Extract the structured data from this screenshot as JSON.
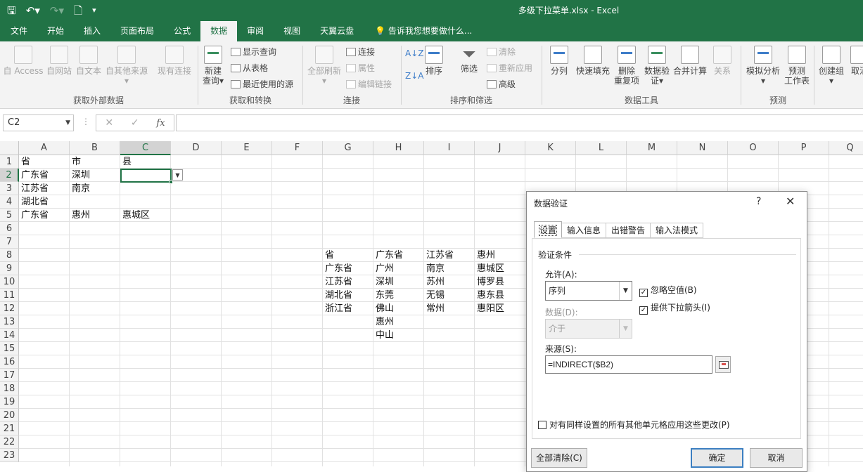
{
  "titlebar": {
    "doc_title": "多级下拉菜单.xlsx - Excel",
    "qat": {
      "save_icon": "save-icon",
      "undo_icon": "undo-icon",
      "redo_icon": "redo-icon",
      "new_icon": "new-file-icon",
      "customize_icon": "customize-qat-icon"
    }
  },
  "tabs": [
    "文件",
    "开始",
    "插入",
    "页面布局",
    "公式",
    "数据",
    "审阅",
    "视图",
    "天翼云盘"
  ],
  "active_tab": "数据",
  "tell_me": "告诉我您想要做什么...",
  "ribbon": {
    "external": {
      "access": "自 Access",
      "web": "自网站",
      "text": "自文本",
      "other": "自其他来源",
      "existing": "现有连接",
      "group": "获取外部数据"
    },
    "transform": {
      "new_query_1": "新建",
      "new_query_2": "查询",
      "show_query": "显示查询",
      "from_table": "从表格",
      "recent": "最近使用的源",
      "group": "获取和转换"
    },
    "connections": {
      "refresh_all": "全部刷新",
      "connections": "连接",
      "properties": "属性",
      "edit_links": "编辑链接",
      "group": "连接"
    },
    "sort_filter": {
      "sort": "排序",
      "filter": "筛选",
      "clear": "清除",
      "reapply": "重新应用",
      "advanced": "高级",
      "group": "排序和筛选"
    },
    "data_tools": {
      "split": "分列",
      "flash_fill": "快速填充",
      "remove_dup_1": "删除",
      "remove_dup_2": "重复项",
      "validation_1": "数据验",
      "validation_2": "证",
      "consolidate": "合并计算",
      "relations": "关系",
      "group": "数据工具"
    },
    "forecast": {
      "what_if": "模拟分析",
      "forecast_1": "预测",
      "forecast_2": "工作表",
      "group": "预测"
    },
    "outline": {
      "group_btn": "创建组",
      "ungroup": "取消"
    }
  },
  "formula_bar": {
    "name_box": "C2",
    "fx": "fx",
    "cancel": "✕",
    "enter": "✓",
    "formula": ""
  },
  "grid": {
    "columns": [
      "A",
      "B",
      "C",
      "D",
      "E",
      "F",
      "G",
      "H",
      "I",
      "J",
      "K",
      "L",
      "M",
      "N",
      "O",
      "P",
      "Q"
    ],
    "rows": [
      "1",
      "2",
      "3",
      "4",
      "5",
      "6",
      "7",
      "8",
      "9",
      "10",
      "11",
      "12",
      "13",
      "14",
      "15",
      "16",
      "17",
      "18",
      "19",
      "20",
      "21",
      "22",
      "23"
    ],
    "cells": {
      "A1": "省",
      "B1": "市",
      "C1": "县",
      "A2": "广东省",
      "B2": "深圳",
      "A3": "江苏省",
      "B3": "南京",
      "A4": "湖北省",
      "A5": "广东省",
      "B5": "惠州",
      "C5": "惠城区",
      "G8": "省",
      "H8": "广东省",
      "I8": "江苏省",
      "J8": "惠州",
      "G9": "广东省",
      "H9": "广州",
      "I9": "南京",
      "J9": "惠城区",
      "G10": "江苏省",
      "H10": "深圳",
      "I10": "苏州",
      "J10": "博罗县",
      "G11": "湖北省",
      "H11": "东莞",
      "I11": "无锡",
      "J11": "惠东县",
      "G12": "浙江省",
      "H12": "佛山",
      "I12": "常州",
      "J12": "惠阳区",
      "H13": "惠州",
      "H14": "中山"
    }
  },
  "dialog": {
    "title": "数据验证",
    "help": "?",
    "close": "✕",
    "tabs": [
      "设置",
      "输入信息",
      "出错警告",
      "输入法模式"
    ],
    "section": "验证条件",
    "allow_label": "允许(A):",
    "allow_value": "序列",
    "data_label": "数据(D):",
    "data_value": "介于",
    "ignore_blank": "忽略空值(B)",
    "ignore_blank_checked": true,
    "dropdown_arrow": "提供下拉箭头(I)",
    "dropdown_arrow_checked": true,
    "source_label": "来源(S):",
    "source_value": "=INDIRECT($B2)",
    "apply_all": "对有同样设置的所有其他单元格应用这些更改(P)",
    "apply_all_checked": false,
    "clear_all": "全部清除(C)",
    "ok": "确定",
    "cancel": "取消"
  }
}
